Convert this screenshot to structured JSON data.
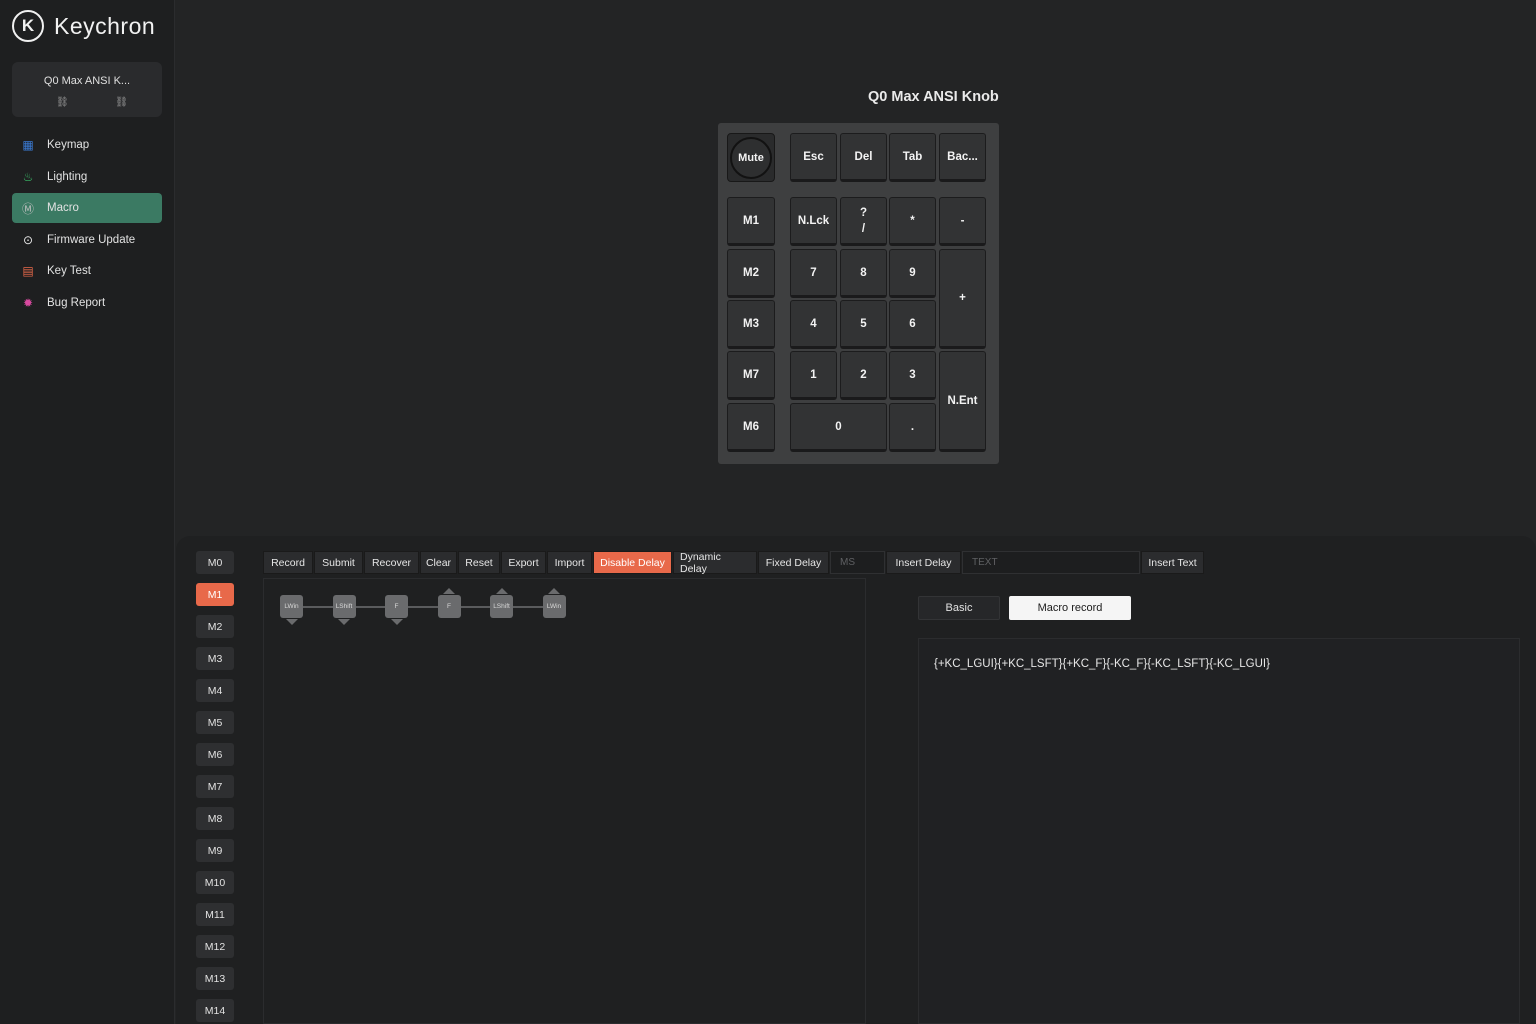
{
  "brand": {
    "logo_glyph": "K",
    "name": "Keychron"
  },
  "device": {
    "name": "Q0 Max ANSI K...",
    "link_glyphs": [
      "⛓",
      "⛓"
    ]
  },
  "nav": [
    {
      "label": "Keymap",
      "icon": "keyboard-icon",
      "glyph": "▦",
      "color": "#3a7bd5",
      "active": false
    },
    {
      "label": "Lighting",
      "icon": "bulb-icon",
      "glyph": "♨",
      "color": "#3bbf6a",
      "active": false
    },
    {
      "label": "Macro",
      "icon": "macro-icon",
      "glyph": "Ⓜ",
      "color": "#bfbfbf",
      "active": true
    },
    {
      "label": "Firmware Update",
      "icon": "firmware-icon",
      "glyph": "⊙",
      "color": "#e6e6e6",
      "active": false
    },
    {
      "label": "Key Test",
      "icon": "key-test-icon",
      "glyph": "▤",
      "color": "#e8694a",
      "active": false
    },
    {
      "label": "Bug Report",
      "icon": "bug-icon",
      "glyph": "✹",
      "color": "#d94aa0",
      "active": false
    }
  ],
  "keyboard": {
    "title": "Q0 Max ANSI Knob",
    "knob_label": "Mute",
    "keys": {
      "esc": "Esc",
      "del": "Del",
      "tab": "Tab",
      "bac": "Bac...",
      "m1": "M1",
      "nlck": "N.Lck",
      "slash_top": "?",
      "slash_bottom": "/",
      "star": "*",
      "minus": "-",
      "m2": "M2",
      "k7": "7",
      "k8": "8",
      "k9": "9",
      "plus": "+",
      "m3": "M3",
      "k4": "4",
      "k5": "5",
      "k6": "6",
      "m7": "M7",
      "k1": "1",
      "k2": "2",
      "k3": "3",
      "nent": "N.Ent",
      "m6": "M6",
      "k0": "0",
      "dot": "."
    }
  },
  "macros": [
    "M0",
    "M1",
    "M2",
    "M3",
    "M4",
    "M5",
    "M6",
    "M7",
    "M8",
    "M9",
    "M10",
    "M11",
    "M12",
    "M13",
    "M14"
  ],
  "selected_macro": "M1",
  "toolbar": {
    "record": "Record",
    "submit": "Submit",
    "recover": "Recover",
    "clear": "Clear",
    "reset": "Reset",
    "export": "Export",
    "import": "Import",
    "disable_delay": "Disable Delay",
    "dynamic_delay": "Dynamic Delay",
    "fixed_delay": "Fixed Delay",
    "ms_placeholder": "MS",
    "insert_delay": "Insert Delay",
    "text_placeholder": "TEXT",
    "insert_text": "Insert Text"
  },
  "sequence": [
    {
      "label": "LWin",
      "dir": "down"
    },
    {
      "label": "LShift",
      "dir": "down"
    },
    {
      "label": "F",
      "dir": "down"
    },
    {
      "label": "F",
      "dir": "up"
    },
    {
      "label": "LShift",
      "dir": "up"
    },
    {
      "label": "LWin",
      "dir": "up"
    }
  ],
  "tabs": {
    "basic": "Basic",
    "macro_record": "Macro record"
  },
  "macro_code": "{+KC_LGUI}{+KC_LSFT}{+KC_F}{-KC_F}{-KC_LSFT}{-KC_LGUI}",
  "colors": {
    "accent": "#e8694a",
    "active_nav": "#3b7a63"
  }
}
